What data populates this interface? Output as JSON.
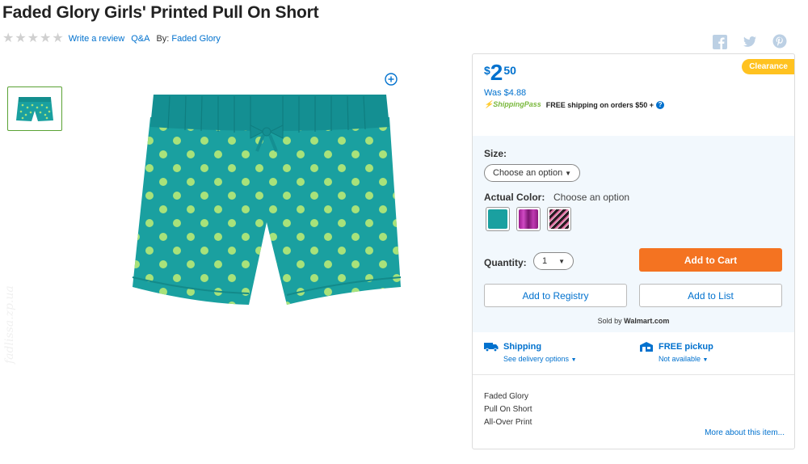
{
  "product": {
    "title": "Faded Glory Girls' Printed Pull On Short"
  },
  "meta": {
    "rating_stars": 0,
    "write_review": "Write a review",
    "qa": "Q&A",
    "by_label": "By:",
    "brand": "Faded Glory"
  },
  "social": {
    "icons": [
      "facebook-icon",
      "twitter-icon",
      "pinterest-icon"
    ]
  },
  "colors": {
    "primary_blue": "#0071ce",
    "cart_orange": "#f47321",
    "clearance_yellow": "#ffc220",
    "shorts_teal": "#1aa0a0",
    "dot_green": "#a8e27a"
  },
  "buybox": {
    "badge": "Clearance",
    "price_currency": "$",
    "price_dollars": "2",
    "price_cents": "50",
    "was_price": "Was $4.88",
    "shippingpass": "ShippingPass",
    "free_shipping": "FREE shipping on orders $50 +",
    "size_label": "Size:",
    "size_value": "Choose an option",
    "color_label": "Actual Color:",
    "color_value": "Choose an option",
    "swatches": [
      "teal",
      "magenta",
      "black-pink-stripe"
    ],
    "quantity_label": "Quantity:",
    "quantity_value": "1",
    "add_to_cart": "Add to Cart",
    "add_to_registry": "Add to Registry",
    "add_to_list": "Add to List",
    "sold_by_prefix": "Sold by",
    "sold_by_seller": "Walmart.com",
    "shipping_title": "Shipping",
    "shipping_sub": "See delivery options",
    "pickup_title": "FREE pickup",
    "pickup_sub": "Not available",
    "features": [
      "Faded Glory",
      "Pull On Short",
      "All-Over Print"
    ],
    "more_link": "More about this item..."
  },
  "watermark": "fadlissa.zp.ua"
}
